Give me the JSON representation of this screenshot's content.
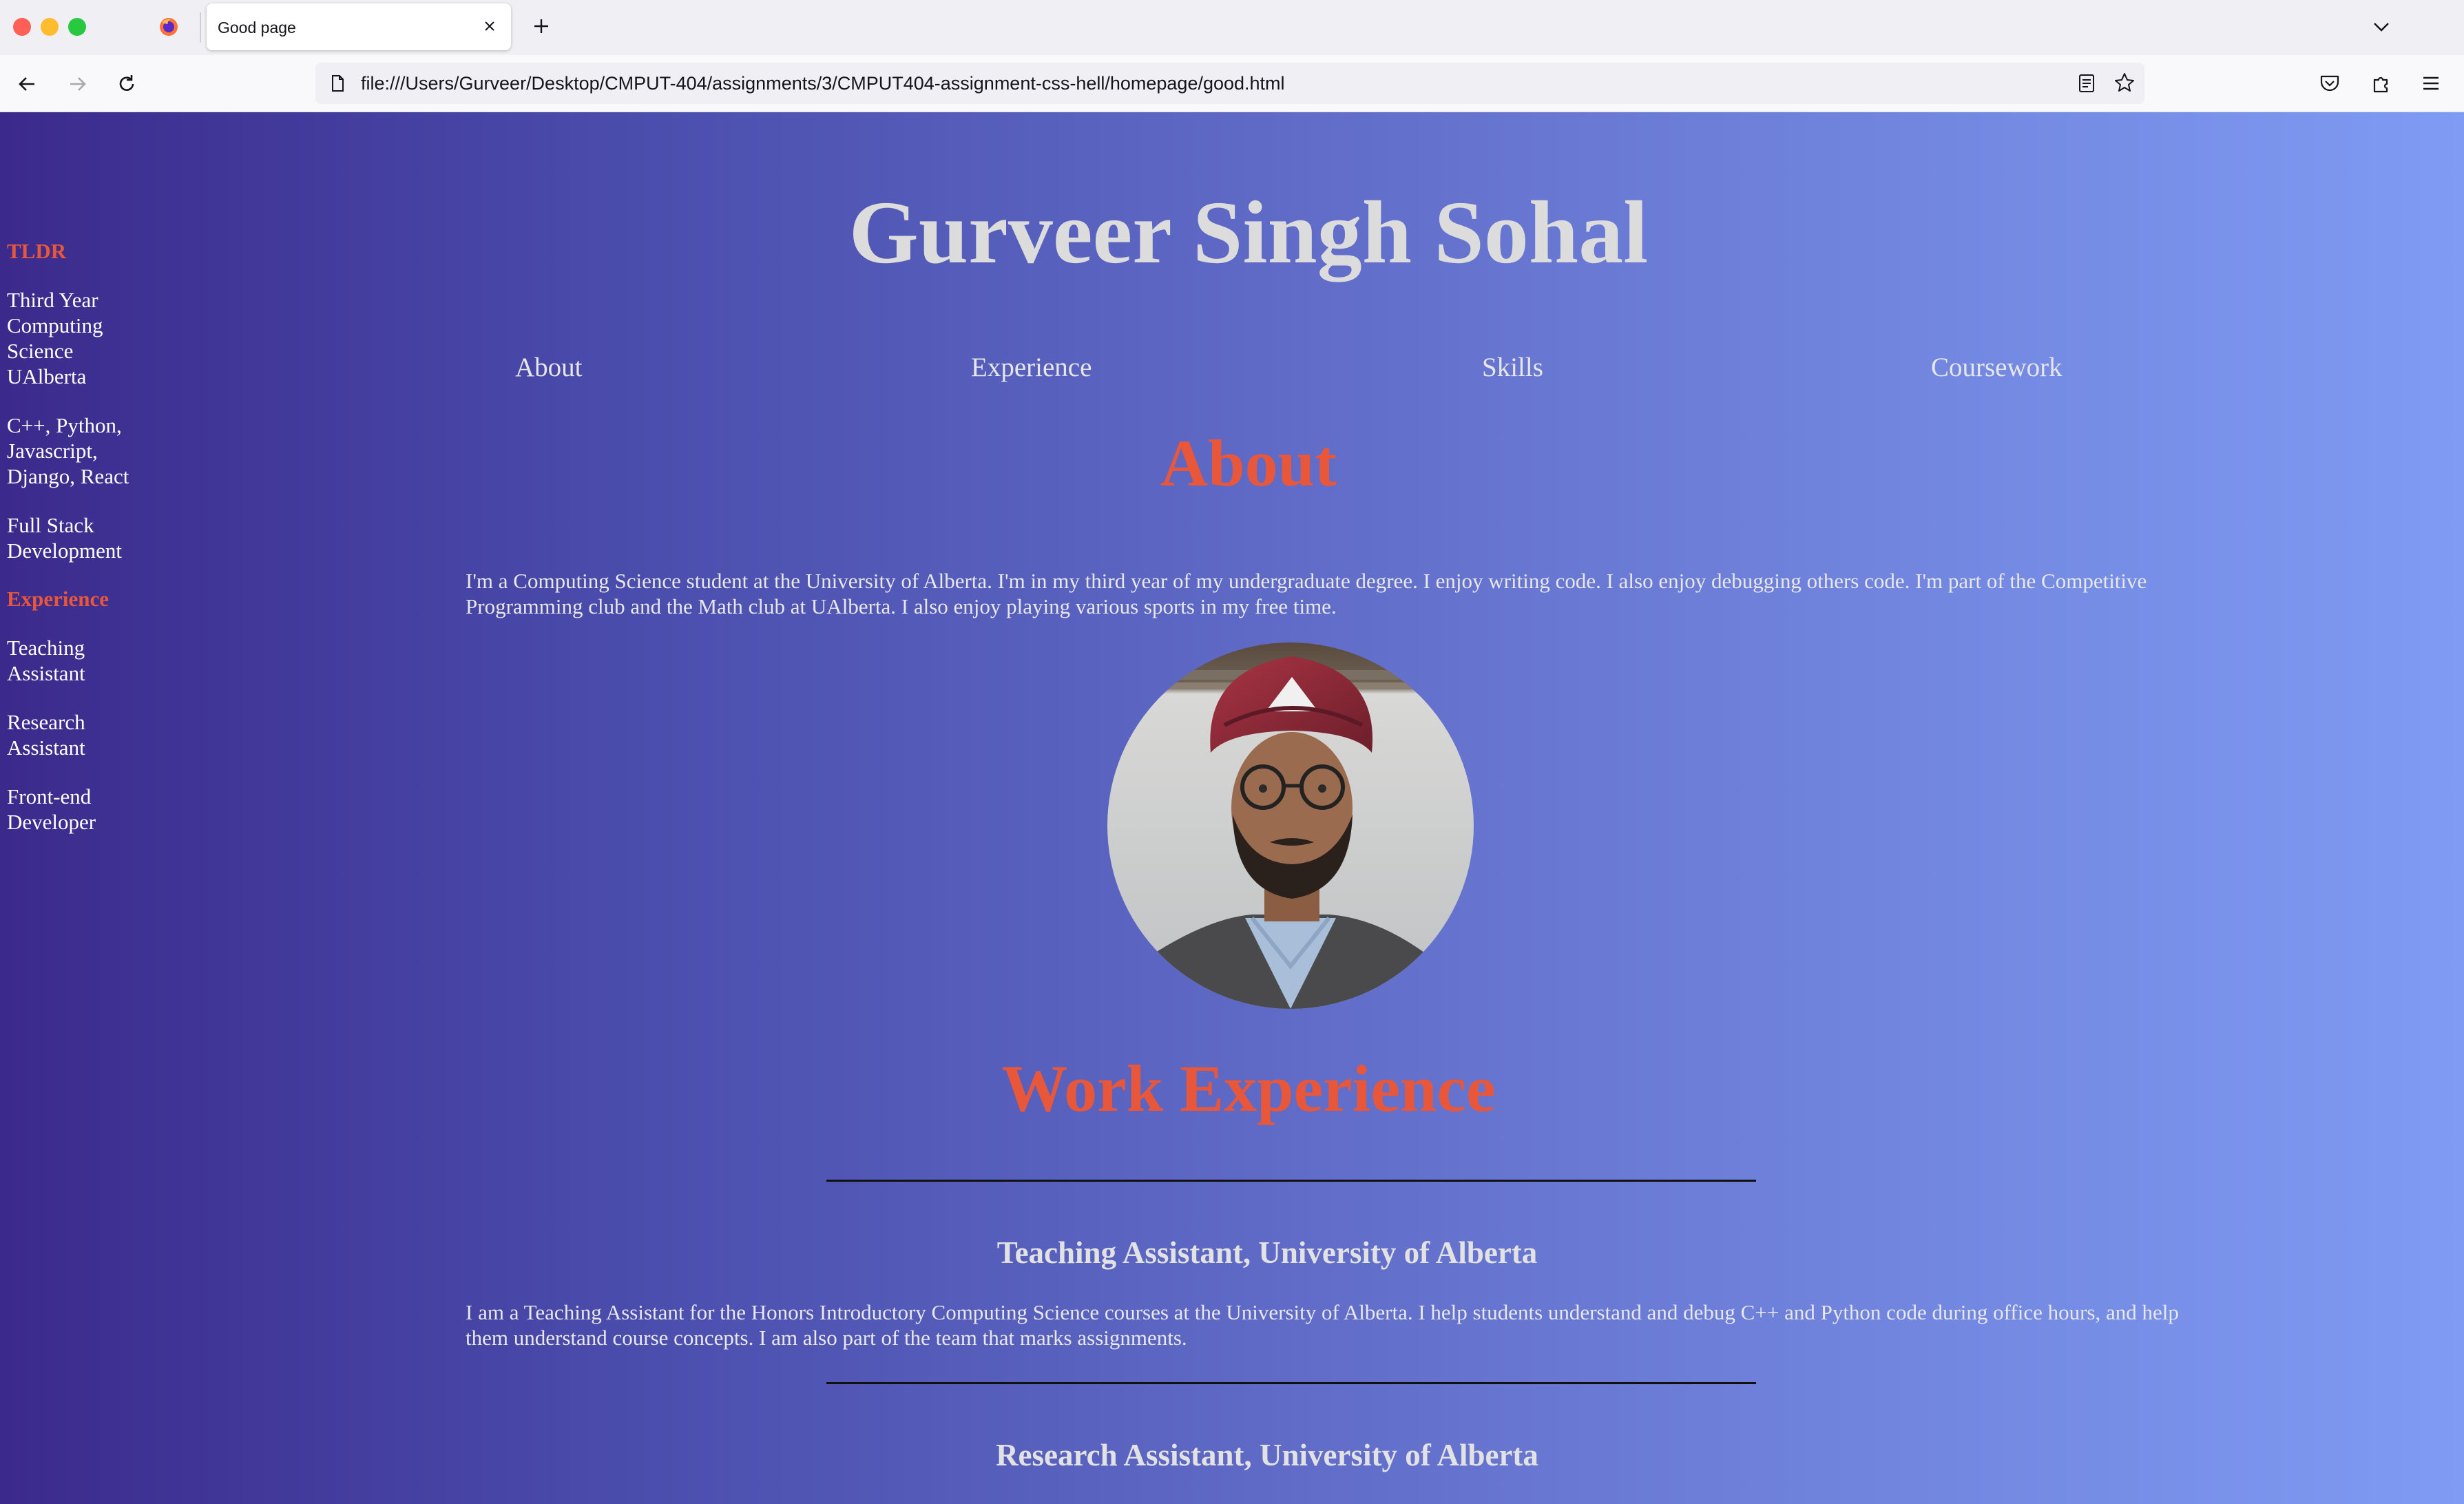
{
  "browser": {
    "tab_title": "Good page",
    "url": "file:///Users/Gurveer/Desktop/CMPUT-404/assignments/3/CMPUT404-assignment-css-hell/homepage/good.html"
  },
  "page": {
    "heading": "Gurveer Singh Sohal",
    "nav": [
      "About",
      "Experience",
      "Skills",
      "Coursework"
    ],
    "sidebar": {
      "tldr_heading": "TLDR",
      "tldr_items": [
        "Third Year Computing Science UAlberta",
        "C++, Python, Javascript, Django, React",
        "Full Stack Development"
      ],
      "experience_heading": "Experience",
      "experience_items": [
        "Teaching Assistant",
        "Research Assistant",
        "Front-end Developer"
      ]
    },
    "about": {
      "title": "About",
      "text": "I'm a Computing Science student at the University of Alberta. I'm in my third year of my undergraduate degree. I enjoy writing code. I also enjoy debugging others code. I'm part of the Competitive Programming club and the Math club at UAlberta. I also enjoy playing various sports in my free time."
    },
    "work": {
      "title": "Work Experience",
      "jobs": [
        {
          "title": "Teaching Assistant, University of Alberta",
          "description": "I am a Teaching Assistant for the Honors Introductory Computing Science courses at the University of Alberta. I help students understand and debug C++ and Python code during office hours, and help them understand course concepts. I am also part of the team that marks assignments."
        },
        {
          "title": "Research Assistant, University of Alberta"
        }
      ]
    }
  },
  "colors": {
    "accent": "#e8573a",
    "gradient_start": "#3b2a8c",
    "gradient_end": "#7f9bf3"
  }
}
